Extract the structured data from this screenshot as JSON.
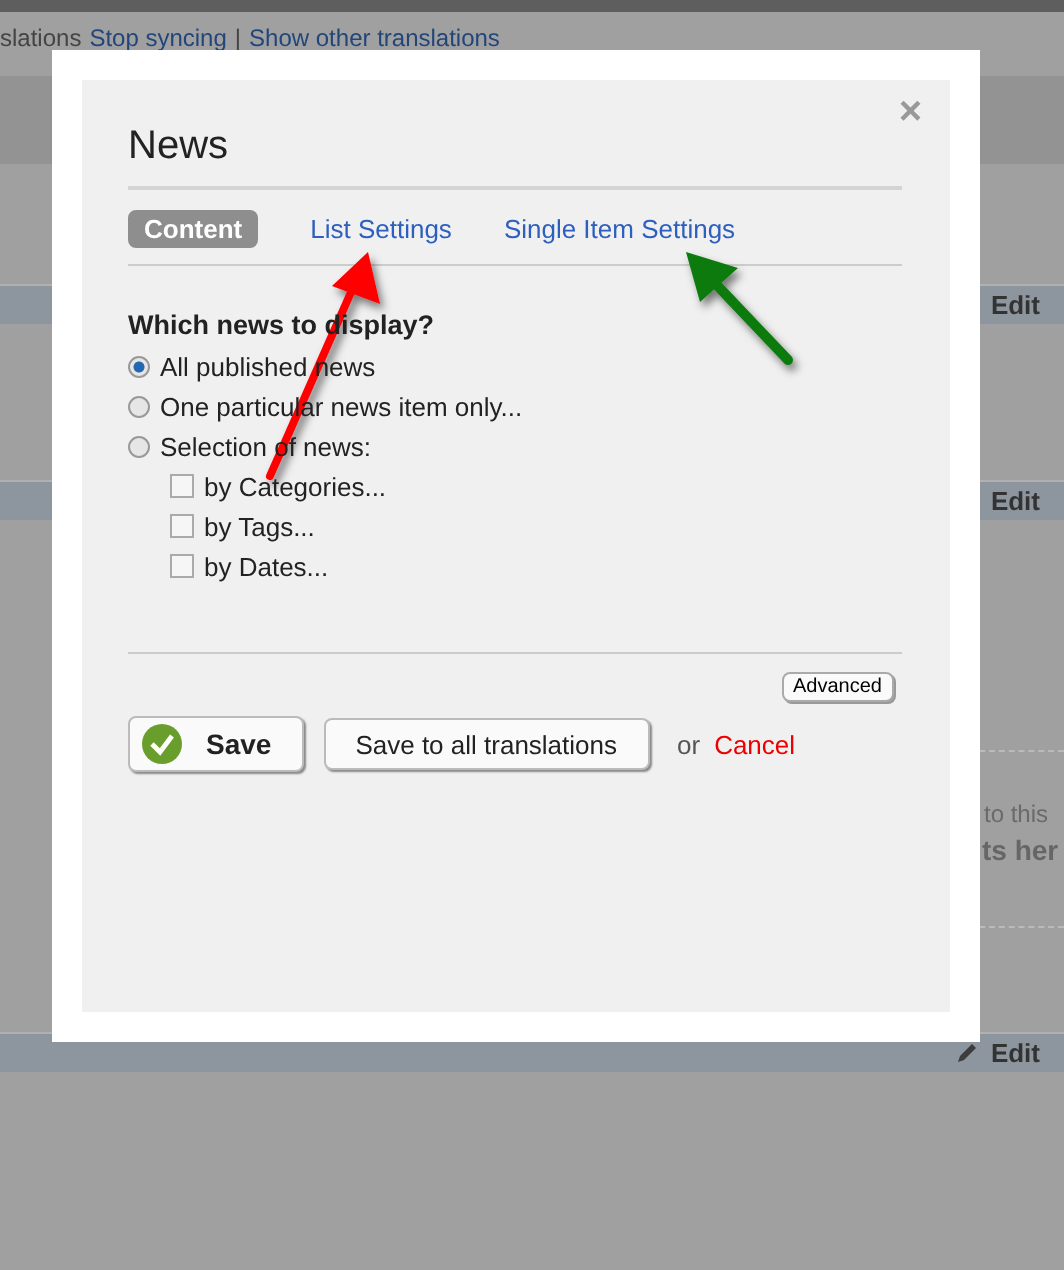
{
  "page": {
    "top_links": [
      {
        "text": "slations",
        "kind": "plain"
      },
      {
        "text": "Stop syncing",
        "kind": "link"
      },
      {
        "text": "|",
        "kind": "plain"
      },
      {
        "text": "Show other translations",
        "kind": "link"
      }
    ],
    "edit_links": [
      "Edit",
      "Edit",
      "Edit"
    ],
    "drop_hint": "to this",
    "drop_heading": "ts her"
  },
  "dialog": {
    "title": "News",
    "close": "×",
    "tabs": [
      {
        "label": "Content",
        "selected": true
      },
      {
        "label": "List Settings",
        "selected": false
      },
      {
        "label": "Single Item Settings",
        "selected": false
      }
    ],
    "question": "Which news to display?",
    "options": [
      {
        "label": "All published news",
        "selected": true
      },
      {
        "label": "One particular news item only...",
        "selected": false
      },
      {
        "label": "Selection of news:",
        "selected": false
      }
    ],
    "filters": [
      {
        "label": "by Categories...",
        "checked": false
      },
      {
        "label": "by Tags...",
        "checked": false
      },
      {
        "label": "by Dates...",
        "checked": false
      }
    ],
    "advanced": "Advanced",
    "save": "Save",
    "save_all": "Save to all translations",
    "or": "or",
    "cancel": "Cancel"
  }
}
